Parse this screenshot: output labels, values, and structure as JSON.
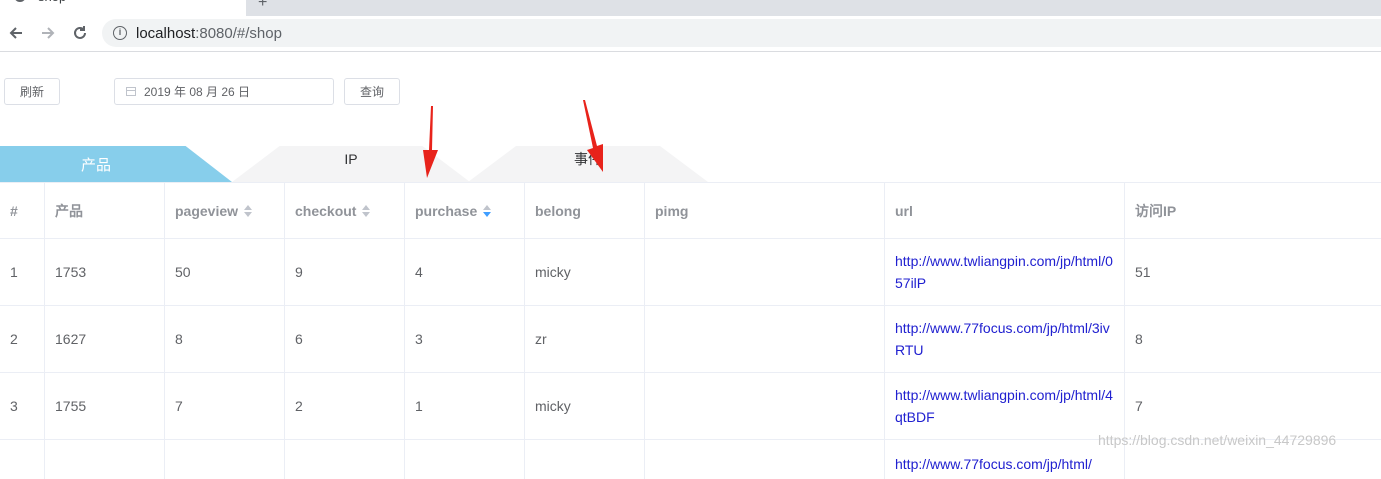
{
  "browser": {
    "tab_title": "shop",
    "newtab_icon": "+",
    "url_host": "localhost",
    "url_rest": ":8080/#/shop"
  },
  "toolbar": {
    "refresh_label": "刷新",
    "date_value": "2019 年 08 月 26 日",
    "query_label": "查询"
  },
  "tabs": [
    {
      "label": "产品",
      "active": true
    },
    {
      "label": "IP",
      "active": false
    },
    {
      "label": "事件",
      "active": false
    }
  ],
  "table": {
    "headers": [
      "#",
      "产品",
      "pageview",
      "checkout",
      "purchase",
      "belong",
      "pimg",
      "url",
      "访问IP"
    ],
    "rows": [
      {
        "idx": "1",
        "product": "1753",
        "pageview": "50",
        "checkout": "9",
        "purchase": "4",
        "belong": "micky",
        "pimg": "",
        "url": "http://www.twliangpin.com/jp/html/057ilP",
        "ip": "51"
      },
      {
        "idx": "2",
        "product": "1627",
        "pageview": "8",
        "checkout": "6",
        "purchase": "3",
        "belong": "zr",
        "pimg": "",
        "url": "http://www.77focus.com/jp/html/3ivRTU",
        "ip": "8"
      },
      {
        "idx": "3",
        "product": "1755",
        "pageview": "7",
        "checkout": "2",
        "purchase": "1",
        "belong": "micky",
        "pimg": "",
        "url": "http://www.twliangpin.com/jp/html/4qtBDF",
        "ip": "7"
      },
      {
        "idx": "",
        "product": "",
        "pageview": "",
        "checkout": "",
        "purchase": "",
        "belong": "",
        "pimg": "",
        "url": "http://www.77focus.com/jp/html/",
        "ip": ""
      }
    ]
  },
  "watermark": "https://blog.csdn.net/weixin_44729896",
  "colors": {
    "tab_active": "#87ceeb",
    "sort_active": "#409eff",
    "link": "#2020d0",
    "annotation_arrow": "#e8231b"
  }
}
